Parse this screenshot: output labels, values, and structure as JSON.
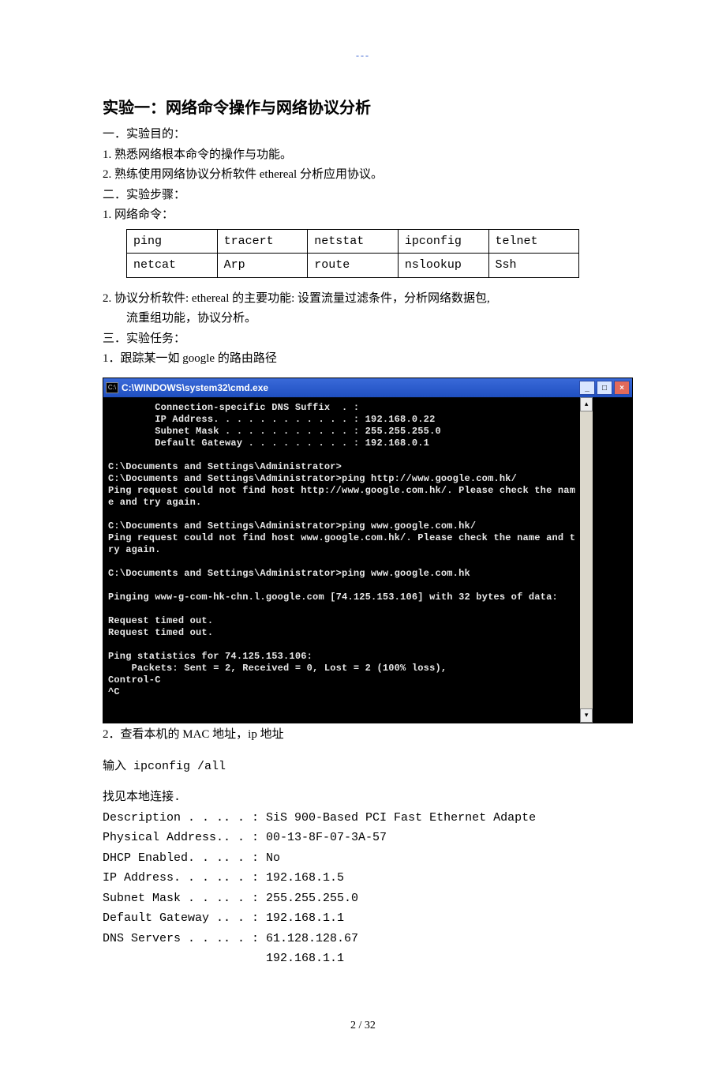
{
  "top_mark": "---",
  "title": "实验一：网络命令操作与网络协议分析",
  "s1_heading": "一．实验目的：",
  "s1_item1": "1.  熟悉网络根本命令的操作与功能。",
  "s1_item2": "2.  熟练使用网络协议分析软件 ethereal 分析应用协议。",
  "s2_heading": "二．实验步骤：",
  "s2_item1": "1.  网络命令：",
  "cmd_table": {
    "rows": [
      [
        "ping",
        "tracert",
        "netstat",
        "ipconfig",
        "telnet"
      ],
      [
        "netcat",
        "Arp",
        "route",
        "nslookup",
        "Ssh"
      ]
    ]
  },
  "s2_item2a": "2.  协议分析软件: ethereal 的主要功能: 设置流量过滤条件，分析网络数据包,",
  "s2_item2b": "流重组功能，协议分析。",
  "s3_heading": "三．实验任务：",
  "s3_item1": "1．跟踪某一如 google 的路由路径",
  "cmd_window": {
    "title": "C:\\WINDOWS\\system32\\cmd.exe",
    "icon_text": "C:\\",
    "content": "        Connection-specific DNS Suffix  . :\n        IP Address. . . . . . . . . . . . : 192.168.0.22\n        Subnet Mask . . . . . . . . . . . : 255.255.255.0\n        Default Gateway . . . . . . . . . : 192.168.0.1\n\nC:\\Documents and Settings\\Administrator>\nC:\\Documents and Settings\\Administrator>ping http://www.google.com.hk/\nPing request could not find host http://www.google.com.hk/. Please check the nam\ne and try again.\n\nC:\\Documents and Settings\\Administrator>ping www.google.com.hk/\nPing request could not find host www.google.com.hk/. Please check the name and t\nry again.\n\nC:\\Documents and Settings\\Administrator>ping www.google.com.hk\n\nPinging www-g-com-hk-chn.l.google.com [74.125.153.106] with 32 bytes of data:\n\nRequest timed out.\nRequest timed out.\n\nPing statistics for 74.125.153.106:\n    Packets: Sent = 2, Received = 0, Lost = 2 (100% loss),\nControl-C\n^C",
    "min_btn": "_",
    "max_btn": "□",
    "close_btn": "×",
    "scroll_up": "▴",
    "scroll_down": "▾"
  },
  "s3_item2": "2．查看本机的 MAC 地址，ip 地址",
  "ipconfig_cmd": "输入 ipconfig /all",
  "ipconfig_output": "找见本地连接.\nDescription . . .. . : SiS 900-Based PCI Fast Ethernet Adapte\nPhysical Address.. . : 00-13-8F-07-3A-57\nDHCP Enabled. . .. . : No\nIP Address. . . .. . : 192.168.1.5\nSubnet Mask . . .. . : 255.255.255.0\nDefault Gateway .. . : 192.168.1.1\nDNS Servers . . .. . : 61.128.128.67\n                       192.168.1.1",
  "page_footer": "2 / 32"
}
